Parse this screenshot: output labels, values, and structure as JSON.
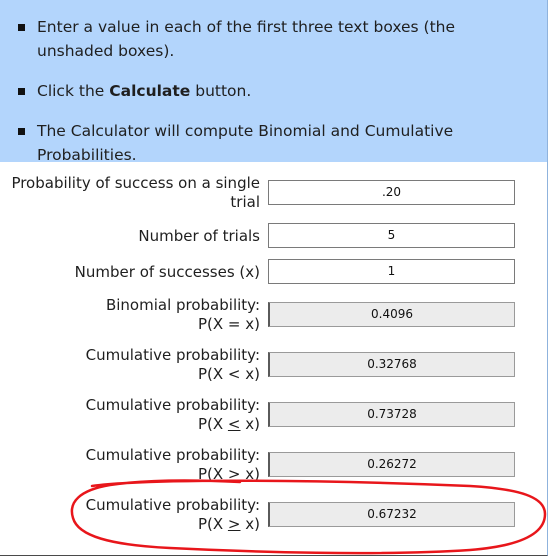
{
  "instructions": [
    {
      "text": "Enter a value in each of the first three text boxes (the unshaded boxes)."
    },
    {
      "pre": "Click the ",
      "bold": "Calculate",
      "post": " button."
    },
    {
      "text": "The Calculator will compute Binomial and Cumulative Probabilities."
    }
  ],
  "form": {
    "probability_label": "Probability of success on a single trial",
    "probability_value": ".20",
    "trials_label": "Number of trials",
    "trials_value": "5",
    "successes_label": "Number of successes (x)",
    "successes_value": "1",
    "binomial_label": "Binomial probability:",
    "binomial_expr": "P(X = x)",
    "binomial_value": "0.4096",
    "cum_lt_label": "Cumulative probability:",
    "cum_lt_expr": "P(X < x)",
    "cum_lt_value": "0.32768",
    "cum_le_label": "Cumulative probability:",
    "cum_le_expr_pre": "P(X ",
    "cum_le_expr_sym": "<",
    "cum_le_expr_post": " x)",
    "cum_le_value": "0.73728",
    "cum_gt_label": "Cumulative probability:",
    "cum_gt_expr": "P(X > x)",
    "cum_gt_value": "0.26272",
    "cum_ge_label": "Cumulative probability:",
    "cum_ge_expr_pre": "P(X ",
    "cum_ge_expr_sym": ">",
    "cum_ge_expr_post": " x)",
    "cum_ge_value": "0.67232"
  },
  "colors": {
    "instructions_bg": "#b3d5fc",
    "output_bg": "#ececec",
    "annotation": "#e8161b"
  }
}
